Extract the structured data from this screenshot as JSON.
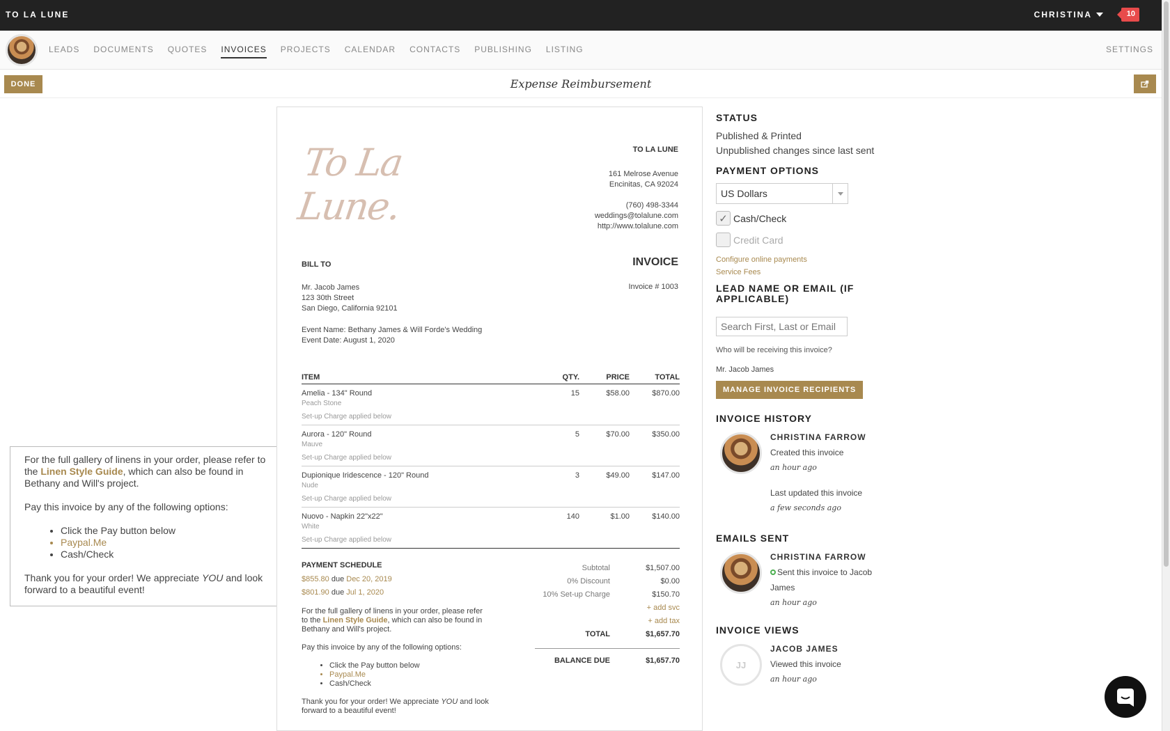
{
  "brand": "TO LA LUNE",
  "user": {
    "name": "CHRISTINA",
    "notifications": "10"
  },
  "nav": {
    "items": [
      "LEADS",
      "DOCUMENTS",
      "QUOTES",
      "INVOICES",
      "PROJECTS",
      "CALENDAR",
      "CONTACTS",
      "PUBLISHING",
      "LISTING"
    ],
    "active": "INVOICES",
    "settings": "SETTINGS"
  },
  "toolbar": {
    "done": "DONE",
    "title": "Expense Reimbursement"
  },
  "note_box": {
    "p1_pre": "For the full gallery of linens in your order, please refer to the ",
    "p1_link": "Linen Style Guide",
    "p1_post": ", which can also be found in Bethany and Will's project.",
    "p2": "Pay this invoice by any of the following options:",
    "options": [
      "Click the Pay button below",
      "Paypal.Me",
      "Cash/Check"
    ],
    "p3_pre": "Thank you for your order! We appreciate ",
    "p3_em": "YOU",
    "p3_post": " and look forward to a beautiful event!"
  },
  "invoice": {
    "logo": "To La Lune.",
    "company": {
      "name": "TO LA LUNE",
      "address1": "161 Melrose Avenue",
      "address2": "Encinitas, CA 92024",
      "phone": "(760) 498-3344",
      "email": "weddings@tolalune.com",
      "web": "http://www.tolalune.com"
    },
    "bill_to_label": "BILL TO",
    "heading": "INVOICE",
    "client": {
      "name": "Mr. Jacob James",
      "street": "123 30th Street",
      "city": "San Diego, California 92101"
    },
    "invoice_no": "Invoice #  1003",
    "event": {
      "name": "Event Name: Bethany James & Will Forde's Wedding",
      "date": "Event Date: August 1, 2020"
    },
    "columns": [
      "ITEM",
      "QTY.",
      "PRICE",
      "TOTAL"
    ],
    "items": [
      {
        "name": "Amelia - 134\" Round",
        "variant": "Peach Stone",
        "note": "Set-up Charge applied below",
        "qty": "15",
        "price": "$58.00",
        "total": "$870.00"
      },
      {
        "name": "Aurora - 120\" Round",
        "variant": "Mauve",
        "note": "Set-up Charge applied below",
        "qty": "5",
        "price": "$70.00",
        "total": "$350.00"
      },
      {
        "name": "Dupionique Iridescence - 120\" Round",
        "variant": "Nude",
        "note": "Set-up Charge applied below",
        "qty": "3",
        "price": "$49.00",
        "total": "$147.00"
      },
      {
        "name": "Nuovo - Napkin 22\"x22\"",
        "variant": "White",
        "note": "Set-up Charge applied below",
        "qty": "140",
        "price": "$1.00",
        "total": "$140.00"
      }
    ],
    "schedule_label": "PAYMENT SCHEDULE",
    "schedule": [
      {
        "amount": "$855.80",
        "due": "due",
        "date": "Dec 20, 2019"
      },
      {
        "amount": "$801.90",
        "due": "due",
        "date": "Jul 1, 2020"
      }
    ],
    "subtotal_label": "Subtotal",
    "subtotal": "$1,507.00",
    "discount_label": "0% Discount",
    "discount": "$0.00",
    "setup_label": "10% Set-up Charge",
    "setup": "$150.70",
    "add_svc": "+ add svc",
    "add_tax": "+ add tax",
    "total_label": "TOTAL",
    "total": "$1,657.70",
    "balance_label": "BALANCE DUE",
    "balance": "$1,657.70"
  },
  "sidebar": {
    "status_h": "STATUS",
    "status1": "Published & Printed",
    "status2": "Unpublished changes since last sent",
    "payment_h": "PAYMENT OPTIONS",
    "currency": "US Dollars",
    "cash": "Cash/Check",
    "card": "Credit Card",
    "configure": "Configure online payments",
    "fees": "Service Fees",
    "lead_h": "LEAD NAME OR EMAIL (IF APPLICABLE)",
    "lead_placeholder": "Search First, Last or Email",
    "who": "Who will be receiving this invoice?",
    "recipient": "Mr. Jacob James",
    "manage": "MANAGE INVOICE RECIPIENTS",
    "history_h": "INVOICE HISTORY",
    "history": {
      "name": "CHRISTINA FARROW",
      "action1": "Created this invoice",
      "time1": "an hour ago",
      "action2": "Last updated this invoice",
      "time2": "a few seconds ago"
    },
    "emails_h": "EMAILS SENT",
    "email": {
      "name": "CHRISTINA FARROW",
      "action": "Sent this invoice to Jacob James",
      "time": "an hour ago"
    },
    "views_h": "INVOICE VIEWS",
    "view": {
      "initials": "JJ",
      "name": "JACOB JAMES",
      "action": "Viewed this invoice",
      "time": "an hour ago"
    }
  }
}
